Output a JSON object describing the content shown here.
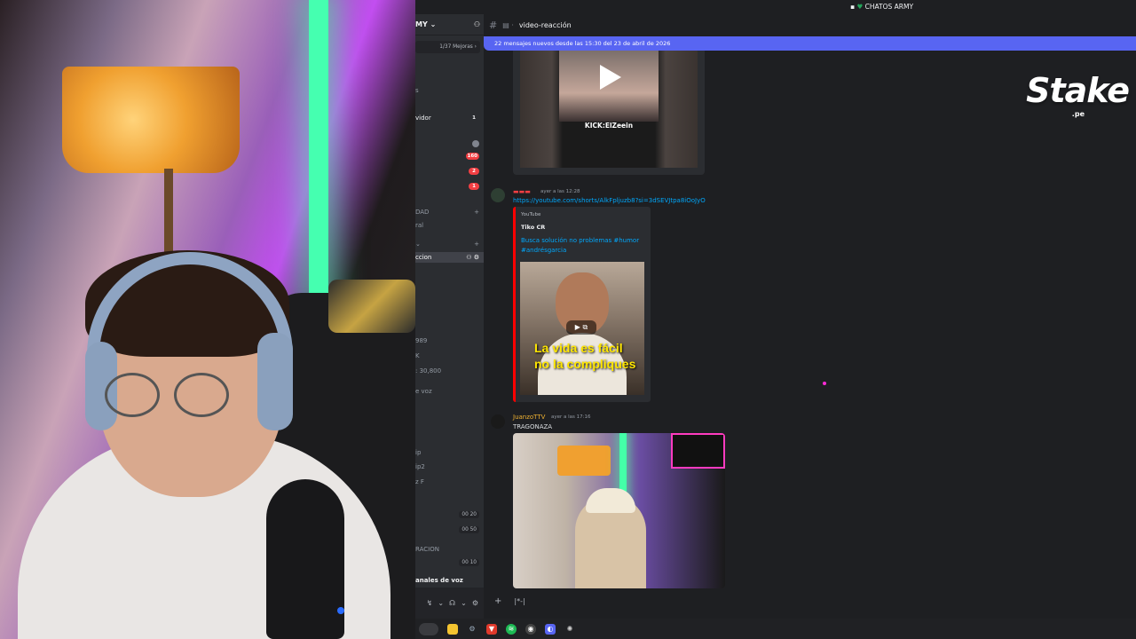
{
  "discord": {
    "server_title": "CHATOS ARMY",
    "server_short": "MY",
    "boost_progress": "1/37 Mejoras",
    "channel_name": "video-reacción",
    "new_messages_banner": "22 mensajes nuevos desde las 15:30 del 23 de abril de 2026"
  },
  "sidebar": {
    "rows": [
      {
        "label": "s",
        "badge": ""
      },
      {
        "label": "vidor",
        "badge": "1"
      },
      {
        "label": "",
        "badge": "",
        "gray": true
      },
      {
        "label": "",
        "badge": "160"
      },
      {
        "label": "",
        "badge": "2"
      },
      {
        "label": "",
        "badge": "1"
      },
      {
        "label": "DAD",
        "badge": "+"
      },
      {
        "label": "ral",
        "badge": ""
      },
      {
        "label": "",
        "badge": "+"
      },
      {
        "label": "ccion",
        "badge": ""
      },
      {
        "label": "989",
        "badge": ""
      },
      {
        "label": "K",
        "badge": ""
      },
      {
        "label": ": 30,800",
        "badge": ""
      },
      {
        "label": "e voz",
        "badge": ""
      },
      {
        "label": "ip",
        "badge": ""
      },
      {
        "label": "ip2",
        "badge": ""
      },
      {
        "label": "z F",
        "badge": ""
      },
      {
        "label": "",
        "badge": "00 20"
      },
      {
        "label": "",
        "badge": "00 50"
      },
      {
        "label": "RACION",
        "badge": ""
      },
      {
        "label": "",
        "badge": "00 10"
      },
      {
        "label": "anales de voz",
        "badge": ""
      }
    ]
  },
  "messages": {
    "video_caption": "KICK:ElZeein",
    "m1_time": "ayer a las 12:28",
    "m1_link": "https://youtube.com/shorts/AlkFpljuzb8?si=3dSEVJtpa8iOoJyO",
    "embed_provider": "YouTube",
    "embed_author": "Tiko CR",
    "embed_title": "Busca solución no problemas #humor #andrésgarcia",
    "embed_overlay_text": "La vida es fácil no la compliques",
    "m2_author": "JuanzoTTV",
    "m2_time": "ayer a las 17:16",
    "m2_text": "TRAGONAZA"
  },
  "composer": {
    "add_label": "+",
    "gif_label": "|*-|"
  },
  "overlay": {
    "brand": "Stake",
    "brand_suffix": ".pe"
  },
  "colors": {
    "accent": "#5865f2",
    "link": "#00a8fc",
    "mention_red": "#f23f43",
    "author_orange": "#f0b232"
  }
}
